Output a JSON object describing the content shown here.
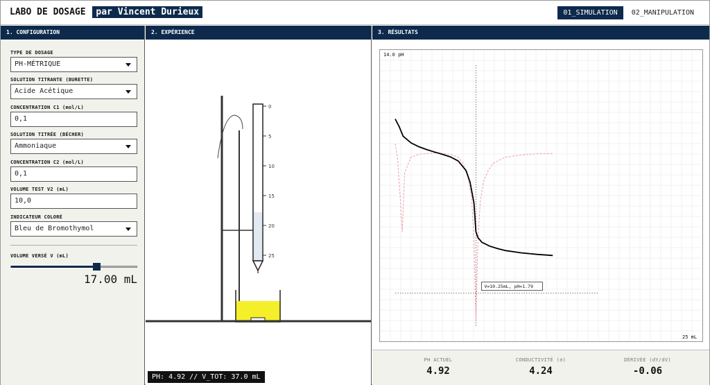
{
  "header": {
    "title": "LABO DE DOSAGE",
    "author": "par Vincent Durieux",
    "tabs": [
      {
        "label": "01_SIMULATION",
        "active": true
      },
      {
        "label": "02_MANIPULATION",
        "active": false
      }
    ]
  },
  "panels": {
    "config": "1. CONFIGURATION",
    "experience": "2. EXPÉRIENCE",
    "results": "3. RÉSULTATS"
  },
  "config": {
    "type_label": "TYPE DE DOSAGE",
    "type_value": "PH-MÉTRIQUE",
    "titrant_label": "SOLUTION TITRANTE (BURETTE)",
    "titrant_value": "Acide Acétique",
    "c1_label": "CONCENTRATION C1 (mol/L)",
    "c1_value": "0,1",
    "titree_label": "SOLUTION TITRÉE (BÉCHER)",
    "titree_value": "Ammoniaque",
    "c2_label": "CONCENTRATION C2 (mol/L)",
    "c2_value": "0,1",
    "v2_label": "VOLUME TEST V2 (mL)",
    "v2_value": "10,0",
    "indicator_label": "INDICATEUR COLORÉ",
    "indicator_value": "Bleu de Bromothymol",
    "volume_label": "VOLUME VERSÉ V (mL)",
    "volume_readout": "17.00 mL",
    "volume_fraction": 0.68
  },
  "experience": {
    "burette_ticks": [
      "0",
      "5",
      "10",
      "15",
      "20",
      "25"
    ],
    "status": "PH: 4.92 // V_TOT: 37.0 mL",
    "solution_color": "#f5ef2a"
  },
  "chart_data": {
    "type": "line",
    "y_axis_label": "14.0 pH",
    "x_axis_label": "25 mL",
    "xlim": [
      0,
      25
    ],
    "ylim": [
      0,
      14
    ],
    "grid": true,
    "series": [
      {
        "kind": "ph_curve",
        "color": "#000000",
        "x": [
          0,
          0.5,
          1,
          2,
          3,
          4,
          5,
          6,
          7,
          8,
          9,
          9.5,
          10,
          10.25,
          10.5,
          11,
          12,
          13,
          14,
          16,
          18,
          20
        ],
        "y": [
          10.9,
          10.5,
          10.0,
          9.65,
          9.45,
          9.3,
          9.17,
          9.05,
          8.92,
          8.7,
          8.2,
          7.6,
          6.5,
          5.0,
          4.7,
          4.45,
          4.25,
          4.12,
          4.02,
          3.9,
          3.82,
          3.76
        ]
      },
      {
        "kind": "derivative",
        "color": "#f29aa8",
        "dashed": true,
        "x": [
          0,
          0.3,
          0.6,
          0.9,
          1.2,
          2,
          3,
          4,
          5,
          6,
          7,
          8,
          8.6,
          9.2,
          9.7,
          10.0,
          10.25,
          10.5,
          10.8,
          11.2,
          11.8,
          12.5,
          14,
          16,
          18,
          20
        ],
        "y": [
          9.6,
          8.8,
          7.0,
          5.0,
          8.1,
          8.9,
          9.05,
          9.1,
          9.12,
          9.1,
          9.05,
          8.9,
          8.6,
          7.9,
          6.8,
          4.5,
          0.3,
          4.5,
          6.6,
          7.6,
          8.2,
          8.6,
          8.9,
          9.02,
          9.08,
          9.1
        ]
      }
    ],
    "equivalence": {
      "x": 10.25,
      "y": 1.79,
      "label": "V=10.25mL, pH=1.79"
    }
  },
  "metrics": [
    {
      "label": "PH ACTUEL",
      "value": "4.92"
    },
    {
      "label": "CONDUCTIVITÉ (σ)",
      "value": "4.24"
    },
    {
      "label": "DÉRIVÉE (dY/dV)",
      "value": "-0.06"
    }
  ]
}
